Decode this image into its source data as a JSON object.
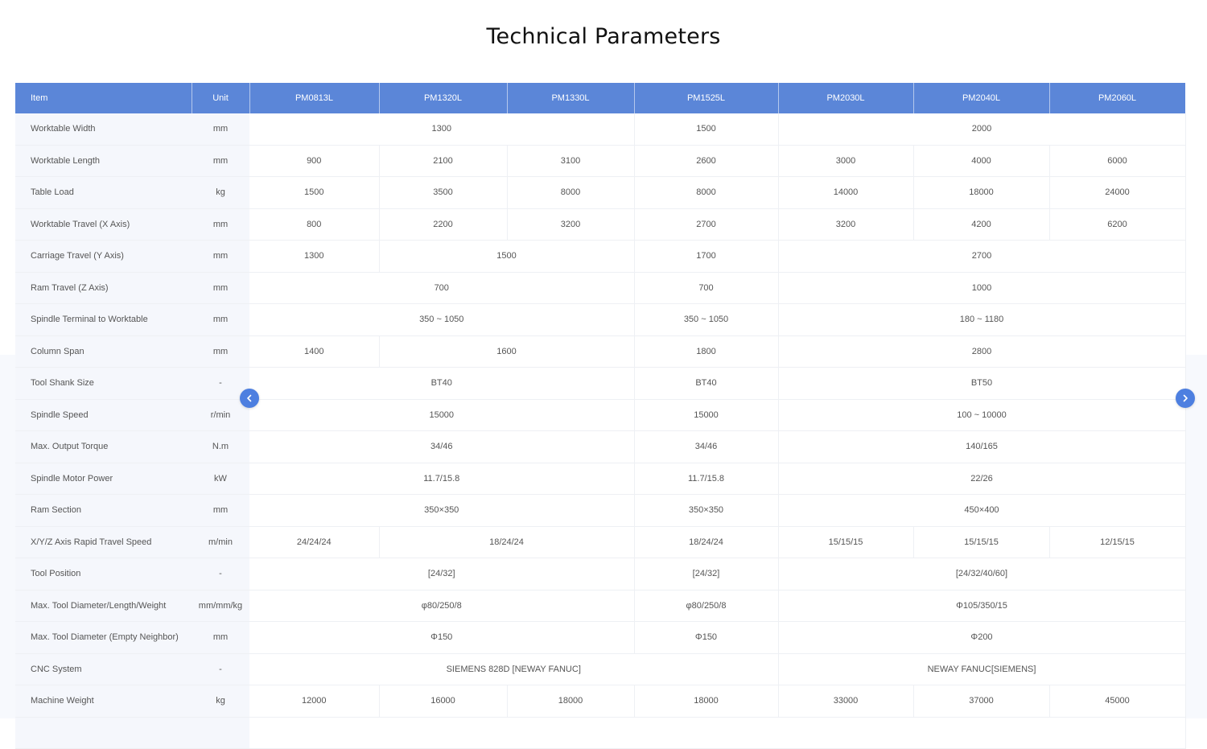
{
  "page": {
    "title": "Technical Parameters"
  },
  "table": {
    "headers": [
      "Item",
      "Unit",
      "PM0813L",
      "PM1320L",
      "PM1330L",
      "PM1525L",
      "PM2030L",
      "PM2040L",
      "PM2060L"
    ],
    "rows": [
      {
        "item": "Worktable   Width",
        "unit": "mm",
        "cells": [
          {
            "v": "1300",
            "span": 3
          },
          {
            "v": "1500",
            "span": 1
          },
          {
            "v": "2000",
            "span": 3
          }
        ]
      },
      {
        "item": "Worktable Length",
        "unit": "mm",
        "cells": [
          {
            "v": "900",
            "span": 1
          },
          {
            "v": "2100",
            "span": 1
          },
          {
            "v": "3100",
            "span": 1
          },
          {
            "v": "2600",
            "span": 1
          },
          {
            "v": "3000",
            "span": 1
          },
          {
            "v": "4000",
            "span": 1
          },
          {
            "v": "6000",
            "span": 1
          }
        ]
      },
      {
        "item": "Table Load",
        "unit": "kg",
        "cells": [
          {
            "v": "1500",
            "span": 1
          },
          {
            "v": "3500",
            "span": 1
          },
          {
            "v": "8000",
            "span": 1
          },
          {
            "v": "8000",
            "span": 1
          },
          {
            "v": "14000",
            "span": 1
          },
          {
            "v": "18000",
            "span": 1
          },
          {
            "v": "24000",
            "span": 1
          }
        ]
      },
      {
        "item": "Worktable Travel (X Axis)",
        "unit": "mm",
        "cells": [
          {
            "v": "800",
            "span": 1
          },
          {
            "v": "2200",
            "span": 1
          },
          {
            "v": "3200",
            "span": 1
          },
          {
            "v": "2700",
            "span": 1
          },
          {
            "v": "3200",
            "span": 1
          },
          {
            "v": "4200",
            "span": 1
          },
          {
            "v": "6200",
            "span": 1
          }
        ]
      },
      {
        "item": "Carriage Travel (Y Axis)",
        "unit": "mm",
        "cells": [
          {
            "v": "1300",
            "span": 1
          },
          {
            "v": "1500",
            "span": 2
          },
          {
            "v": "1700",
            "span": 1
          },
          {
            "v": "2700",
            "span": 3
          }
        ]
      },
      {
        "item": "Ram Travel (Z Axis)",
        "unit": "mm",
        "cells": [
          {
            "v": "700",
            "span": 3
          },
          {
            "v": "700",
            "span": 1
          },
          {
            "v": "1000",
            "span": 3
          }
        ]
      },
      {
        "item": "Spindle Terminal to Worktable",
        "unit": "mm",
        "cells": [
          {
            "v": "350 ~ 1050",
            "span": 3
          },
          {
            "v": "350 ~ 1050",
            "span": 1
          },
          {
            "v": "180 ~ 1180",
            "span": 3
          }
        ]
      },
      {
        "item": "Column Span",
        "unit": "mm",
        "cells": [
          {
            "v": "1400",
            "span": 1
          },
          {
            "v": "1600",
            "span": 2
          },
          {
            "v": "1800",
            "span": 1
          },
          {
            "v": "2800",
            "span": 3
          }
        ]
      },
      {
        "item": "Tool Shank Size",
        "unit": "-",
        "cells": [
          {
            "v": "BT40",
            "span": 3
          },
          {
            "v": "BT40",
            "span": 1
          },
          {
            "v": "BT50",
            "span": 3
          }
        ]
      },
      {
        "item": "Spindle Speed",
        "unit": "r/min",
        "cells": [
          {
            "v": "15000",
            "span": 3
          },
          {
            "v": "15000",
            "span": 1
          },
          {
            "v": "100 ~ 10000",
            "span": 3
          }
        ]
      },
      {
        "item": "Max. Output Torque",
        "unit": "N.m",
        "cells": [
          {
            "v": "34/46",
            "span": 3
          },
          {
            "v": "34/46",
            "span": 1
          },
          {
            "v": "140/165",
            "span": 3
          }
        ]
      },
      {
        "item": "Spindle Motor Power",
        "unit": "kW",
        "cells": [
          {
            "v": "11.7/15.8",
            "span": 3
          },
          {
            "v": "11.7/15.8",
            "span": 1
          },
          {
            "v": "22/26",
            "span": 3
          }
        ]
      },
      {
        "item": "Ram Section",
        "unit": "mm",
        "cells": [
          {
            "v": "350×350",
            "span": 3
          },
          {
            "v": "350×350",
            "span": 1
          },
          {
            "v": "450×400",
            "span": 3
          }
        ]
      },
      {
        "item": "X/Y/Z Axis Rapid Travel Speed",
        "unit": "m/min",
        "cells": [
          {
            "v": "24/24/24",
            "span": 1
          },
          {
            "v": "18/24/24",
            "span": 2
          },
          {
            "v": "18/24/24",
            "span": 1
          },
          {
            "v": "15/15/15",
            "span": 1
          },
          {
            "v": "15/15/15",
            "span": 1
          },
          {
            "v": "12/15/15",
            "span": 1
          }
        ]
      },
      {
        "item": "Tool Position",
        "unit": "-",
        "cells": [
          {
            "v": "[24/32]",
            "span": 3
          },
          {
            "v": "[24/32]",
            "span": 1
          },
          {
            "v": "[24/32/40/60]",
            "span": 3
          }
        ]
      },
      {
        "item": "Max. Tool Diameter/Length/Weight",
        "unit": "mm/mm/kg",
        "cells": [
          {
            "v": "φ80/250/8",
            "span": 3
          },
          {
            "v": "φ80/250/8",
            "span": 1
          },
          {
            "v": "Φ105/350/15",
            "span": 3
          }
        ]
      },
      {
        "item": "Max. Tool Diameter (Empty Neighbor)",
        "unit": "mm",
        "cells": [
          {
            "v": "Φ150",
            "span": 3
          },
          {
            "v": "Φ150",
            "span": 1
          },
          {
            "v": "Φ200",
            "span": 3
          }
        ]
      },
      {
        "item": "CNC System",
        "unit": "-",
        "cells": [
          {
            "v": "SIEMENS 828D [NEWAY FANUC]",
            "span": 4
          },
          {
            "v": "NEWAY   FANUC[SIEMENS]",
            "span": 3
          }
        ]
      },
      {
        "item": "Machine Weight",
        "unit": "kg",
        "cells": [
          {
            "v": "12000",
            "span": 1
          },
          {
            "v": "16000",
            "span": 1
          },
          {
            "v": "18000",
            "span": 1
          },
          {
            "v": "18000",
            "span": 1
          },
          {
            "v": "33000",
            "span": 1
          },
          {
            "v": "37000",
            "span": 1
          },
          {
            "v": "45000",
            "span": 1
          }
        ]
      }
    ]
  },
  "controls": {
    "prev_icon": "chevron-left-icon",
    "next_icon": "chevron-right-icon",
    "accent_color": "#4d7fe0",
    "header_color": "#5b86d8"
  }
}
